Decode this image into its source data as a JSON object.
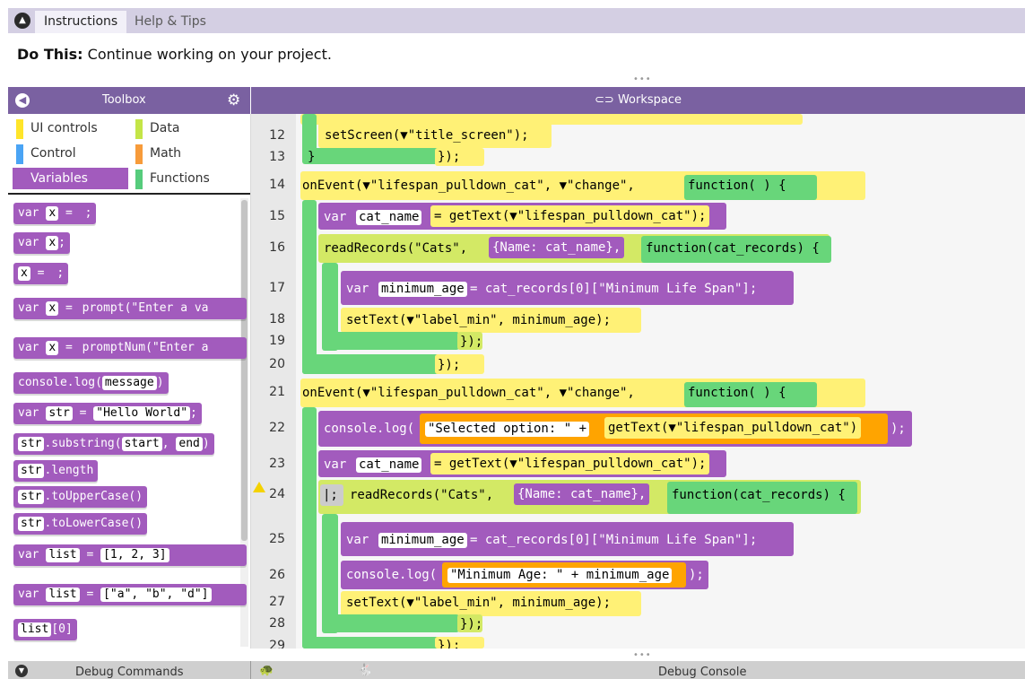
{
  "top": {
    "tabs": [
      {
        "label": "Instructions"
      },
      {
        "label": "Help & Tips"
      }
    ],
    "do_this_label": "Do This:",
    "do_this_text": "Continue working on your project."
  },
  "toolbox": {
    "title": "Toolbox",
    "categories": [
      {
        "label": "UI controls",
        "color": "#ffe52a"
      },
      {
        "label": "Data",
        "color": "#c4e547"
      },
      {
        "label": "Control",
        "color": "#4aa4f5"
      },
      {
        "label": "Math",
        "color": "#f79b3a"
      },
      {
        "label": "Variables",
        "color": "#a25bbd"
      },
      {
        "label": "Functions",
        "color": "#56cc7c"
      }
    ],
    "blocks": [
      [
        "var ",
        "x",
        " = ",
        " ",
        ";"
      ],
      [
        "var ",
        "x",
        ";"
      ],
      [
        "x",
        " = ",
        " ",
        ";"
      ],
      [
        "var ",
        "x",
        " = ",
        "prompt(\"Enter a va"
      ],
      [
        "var ",
        "x",
        " = ",
        "promptNum(\"Enter a"
      ],
      [
        "console.log(",
        "message",
        ")"
      ],
      [
        "var ",
        "str",
        " = ",
        "\"Hello World\"",
        ";"
      ],
      [
        "str",
        ".substring(",
        "start",
        ", ",
        "end",
        ")"
      ],
      [
        "str",
        ".length"
      ],
      [
        "str",
        ".toUpperCase()"
      ],
      [
        "str",
        ".toLowerCase()"
      ],
      [
        "var ",
        "list",
        " = ",
        "[1, 2, 3]"
      ],
      [
        "var ",
        "list",
        " = ",
        "[\"a\", \"b\", \"d\"]"
      ],
      [
        "list",
        "[0]"
      ]
    ]
  },
  "workspace": {
    "title": "Workspace",
    "line_numbers": [
      "12",
      "13",
      "14",
      "15",
      "16",
      "17",
      "18",
      "19",
      "20",
      "21",
      "22",
      "23",
      "24",
      "25",
      "26",
      "27",
      "28",
      "29"
    ],
    "lines": {
      "l12": "setScreen(▼\"title_screen\");",
      "l13": "});",
      "l14a": "onEvent(▼\"lifespan_pulldown_cat\", ▼\"change\",",
      "l14b": "function( ) {",
      "l15a": "var",
      "l15b": "cat_name",
      "l15c": "= getText(▼\"lifespan_pulldown_cat\");",
      "l16a": "readRecords(\"Cats\",",
      "l16b": "{Name: cat_name},",
      "l16c": "function(cat_records) {",
      "l17a": "var",
      "l17b": "minimum_age",
      "l17c": "= cat_records[0][\"Minimum Life Span\"];",
      "l18": "setText(▼\"label_min\", minimum_age);",
      "l19": "});",
      "l20": "});",
      "l21a": "onEvent(▼\"lifespan_pulldown_cat\", ▼\"change\",",
      "l21b": "function( ) {",
      "l22a": "console.log(",
      "l22b": "\"Selected option: \" +",
      "l22c": "getText(▼\"lifespan_pulldown_cat\")",
      "l22d": ");",
      "l23a": "var",
      "l23b": "cat_name",
      "l23c": "= getText(▼\"lifespan_pulldown_cat\");",
      "l24a": "|;",
      "l24b": "readRecords(\"Cats\",",
      "l24c": "{Name: cat_name},",
      "l24d": "function(cat_records) {",
      "l25a": "var",
      "l25b": "minimum_age",
      "l25c": "= cat_records[0][\"Minimum Life Span\"];",
      "l26a": "console.log(",
      "l26b": "\"Minimum Age: \" + minimum_age",
      "l26c": ");",
      "l27": "setText(▼\"label_min\", minimum_age);",
      "l28": "});",
      "l29": "});"
    }
  },
  "bottom": {
    "debug_commands": "Debug Commands",
    "debug_console": "Debug Console"
  }
}
